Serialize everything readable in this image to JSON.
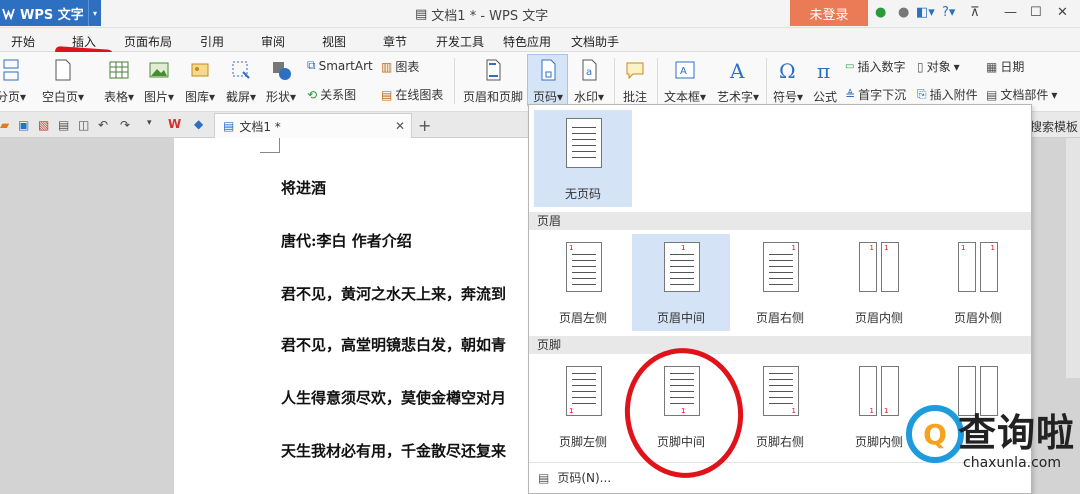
{
  "app": {
    "name": "WPS 文字",
    "window_title": "文档1 * - WPS 文字",
    "login": "未登录"
  },
  "menu": {
    "tabs": [
      "开始",
      "插入",
      "页面布局",
      "引用",
      "审阅",
      "视图",
      "章节",
      "开发工具",
      "特色应用",
      "文档助手"
    ],
    "active": "插入"
  },
  "ribbon": {
    "page_break": "分页",
    "blank_page": "空白页",
    "table": "表格",
    "picture": "图片",
    "gallery": "图库",
    "screenshot": "截屏",
    "shape": "形状",
    "smartart": "SmartArt",
    "chart": "图表",
    "relation": "关系图",
    "online_chart": "在线图表",
    "header_footer": "页眉和页脚",
    "page_number": "页码",
    "watermark": "水印",
    "comment": "批注",
    "textbox": "文本框",
    "wordart": "艺术字",
    "symbol": "符号",
    "formula": "公式",
    "insert_number": "插入数字",
    "object": "对象",
    "date": "日期",
    "drop_cap": "首字下沉",
    "attachment": "插入附件",
    "doc_parts": "文档部件"
  },
  "doc_tab": {
    "name": "文档1 *"
  },
  "template_search": "搜索模板",
  "document": {
    "lines": [
      "将进酒",
      "唐代:李白 作者介绍",
      "君不见，黄河之水天上来，奔流到",
      "君不见，高堂明镜悲白发，朝如青",
      "人生得意须尽欢，莫使金樽空对月",
      "天生我材必有用，千金散尽还复来"
    ]
  },
  "dropdown": {
    "none": "无页码",
    "header_section": "页眉",
    "header_options": [
      "页眉左侧",
      "页眉中间",
      "页眉右侧",
      "页眉内侧",
      "页眉外侧"
    ],
    "footer_section": "页脚",
    "footer_options": [
      "页脚左侧",
      "页脚中间",
      "页脚右侧",
      "页脚内侧"
    ],
    "footer_link": "页码(N)..."
  },
  "watermark": {
    "text": "查询啦",
    "url": "chaxunla.com",
    "glyph": "Q"
  },
  "colors": {
    "app_blue": "#2d6fc0",
    "login_orange": "#ea7b56",
    "highlight": "#d5e3f6",
    "annotation_red": "#e0121a"
  }
}
